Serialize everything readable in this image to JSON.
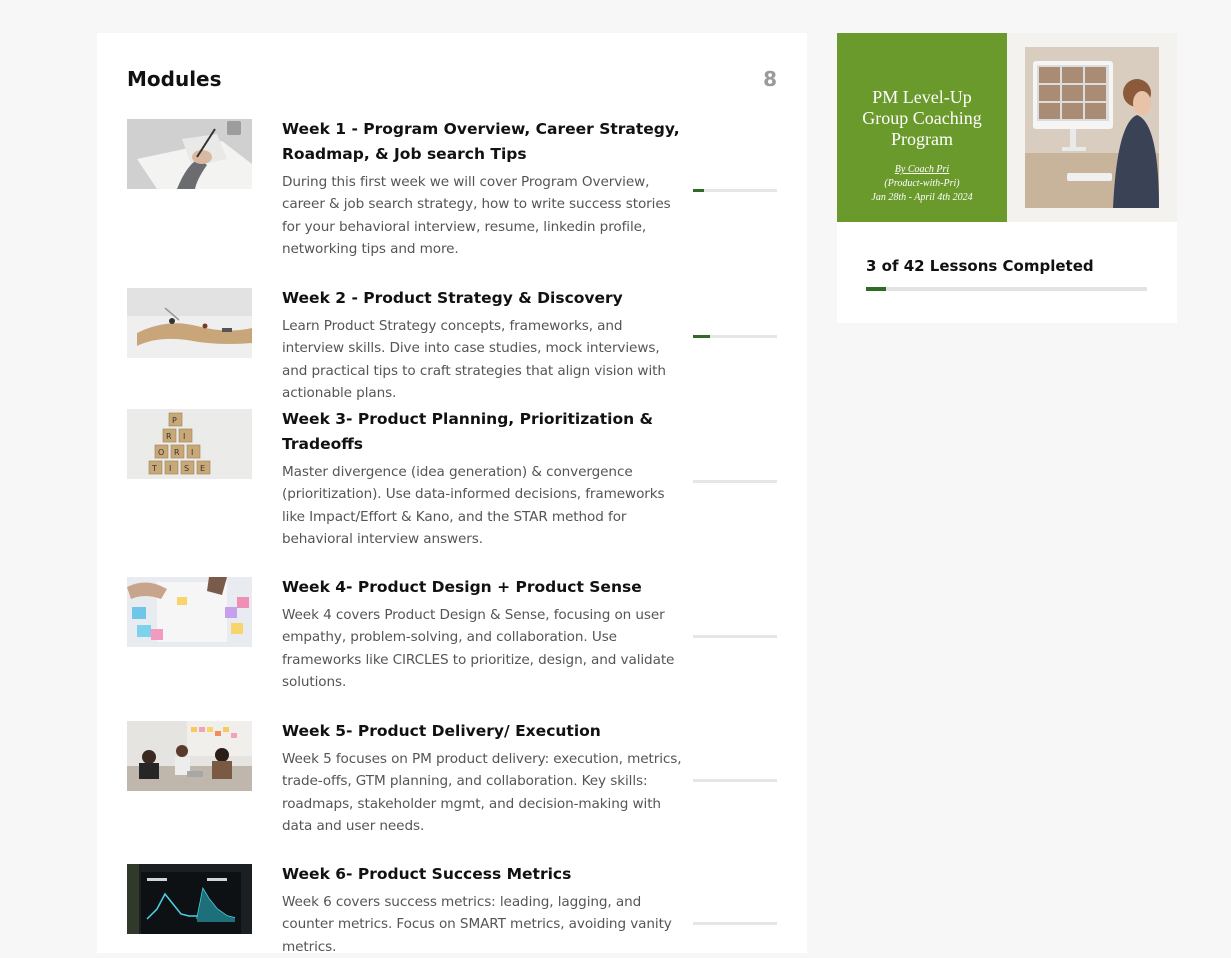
{
  "modules_panel": {
    "title": "Modules",
    "count": "8"
  },
  "modules": [
    {
      "title": "Week 1 - Program Overview, Career Strategy, Roadmap, & Job search Tips",
      "description": "During this first week we will cover Program Overview, career & job search strategy, how to write success stories for your behavioral interview, resume, linkedin profile, networking tips and more.",
      "progress": 0.13
    },
    {
      "title": "Week 2 - Product Strategy & Discovery",
      "description": "Learn Product Strategy concepts, frameworks, and interview skills. Dive into case studies, mock interviews, and practical tips to craft strategies that align vision with actionable plans.",
      "progress": 0.2
    },
    {
      "title": "Week 3- Product Planning, Prioritization & Tradeoffs",
      "description": "Master divergence (idea generation) & convergence (prioritization). Use data-informed decisions, frameworks like Impact/Effort & Kano, and the STAR method for behavioral interview answers.",
      "progress": 0
    },
    {
      "title": "Week 4- Product Design + Product Sense",
      "description": "Week 4 covers Product Design & Sense, focusing on user empathy, problem-solving, and collaboration. Use frameworks like CIRCLES to prioritize, design, and validate solutions.",
      "progress": 0
    },
    {
      "title": "Week 5- Product Delivery/ Execution",
      "description": "Week 5 focuses on PM product delivery: execution, metrics, trade-offs, GTM planning, and collaboration. Key skills: roadmaps, stakeholder mgmt, and decision-making with data and user needs.",
      "progress": 0
    },
    {
      "title": "Week 6- Product Success Metrics",
      "description": "Week 6 covers success metrics: leading, lagging, and counter metrics. Focus on SMART metrics, avoiding vanity metrics.",
      "progress": 0
    }
  ],
  "course_card": {
    "banner": {
      "line1": "PM Level-Up",
      "line2": "Group Coaching",
      "line3": "Program",
      "by": "By Coach Pri",
      "handle": "(Product-with-Pri)",
      "dates": "Jan 28th - April 4th 2024"
    },
    "progress_label": "3 of 42 Lessons Completed",
    "progress": 0.07
  },
  "colors": {
    "accent": "#2f6b26",
    "banner_green": "#6a9a2c",
    "muted_text": "#555555",
    "count_gray": "#9a9a9a"
  },
  "icons": {
    "w1": "writing-hand-photo",
    "w2": "desk-objects-photo",
    "w3": "scrabble-tiles-photo",
    "w4": "sticky-notes-photo",
    "w5": "team-meeting-photo",
    "w6": "metrics-dashboard-photo"
  }
}
